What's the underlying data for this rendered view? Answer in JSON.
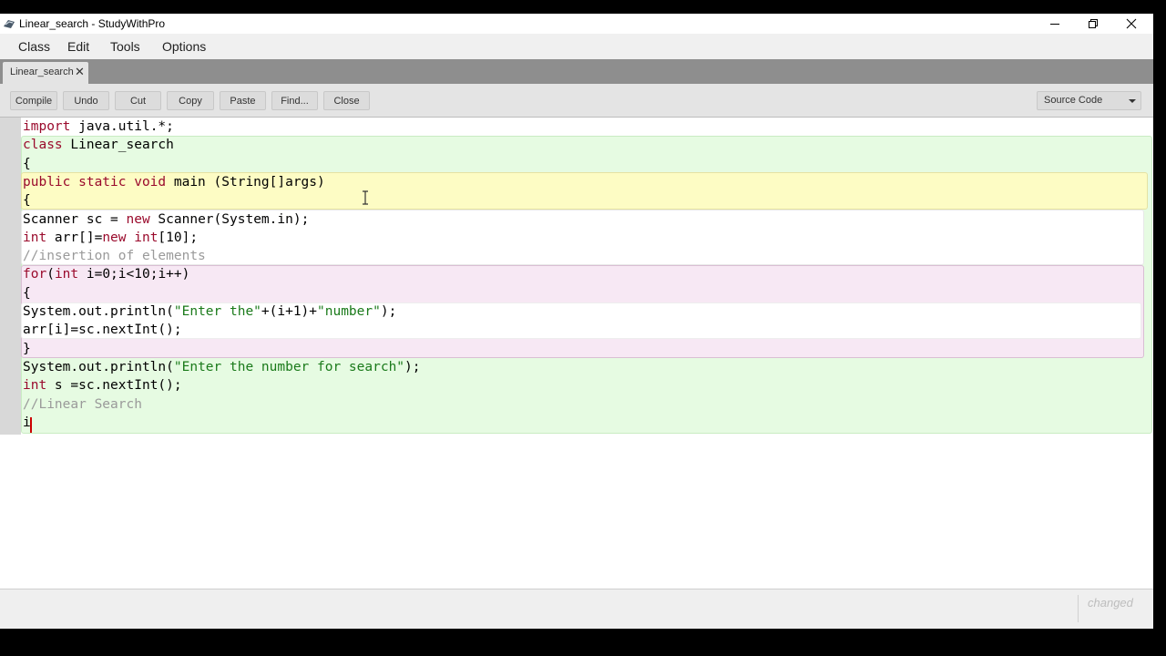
{
  "window": {
    "title": "Linear_search - StudyWithPro",
    "controls": {
      "minimize_icon": "minimize-icon",
      "restore_icon": "restore-icon",
      "close_icon": "close-icon"
    }
  },
  "menu": [
    "Class",
    "Edit",
    "Tools",
    "Options"
  ],
  "tab": {
    "label": "Linear_search",
    "close_glyph": "✕"
  },
  "toolbar": {
    "buttons": [
      "Compile",
      "Undo",
      "Cut",
      "Copy",
      "Paste",
      "Find...",
      "Close"
    ],
    "view_select": "Source Code"
  },
  "code": [
    [
      [
        "kw",
        "import"
      ],
      [
        "t",
        " java.util.*;"
      ]
    ],
    [
      [
        "kw",
        "class"
      ],
      [
        "t",
        " Linear_search"
      ]
    ],
    [
      [
        "t",
        "{"
      ]
    ],
    [
      [
        "kw",
        "public static void"
      ],
      [
        "t",
        " main (String[]args)"
      ]
    ],
    [
      [
        "t",
        "{"
      ]
    ],
    [
      [
        "t",
        "Scanner sc = "
      ],
      [
        "kw",
        "new"
      ],
      [
        "t",
        " Scanner(System.in);"
      ]
    ],
    [
      [
        "kw",
        "int"
      ],
      [
        "t",
        " arr[]="
      ],
      [
        "kw",
        "new int"
      ],
      [
        "t",
        "[10];"
      ]
    ],
    [
      [
        "cmt",
        "//insertion of elements"
      ]
    ],
    [
      [
        "kw",
        "for"
      ],
      [
        "t",
        "("
      ],
      [
        "kw",
        "int"
      ],
      [
        "t",
        " i=0;i<10;i++)"
      ]
    ],
    [
      [
        "t",
        "{"
      ]
    ],
    [
      [
        "t",
        "System.out.println("
      ],
      [
        "str",
        "\"Enter the\""
      ],
      [
        "t",
        "+(i+1)+"
      ],
      [
        "str",
        "\"number\""
      ],
      [
        "t",
        ");"
      ]
    ],
    [
      [
        "t",
        "arr[i]=sc.nextInt();"
      ]
    ],
    [
      [
        "t",
        "}"
      ]
    ],
    [
      [
        "t",
        "System.out.println("
      ],
      [
        "str",
        "\"Enter the number for search\""
      ],
      [
        "t",
        ");"
      ]
    ],
    [
      [
        "kw",
        "int"
      ],
      [
        "t",
        " s =sc.nextInt();"
      ]
    ],
    [
      [
        "cmt",
        "//Linear Search"
      ]
    ],
    [
      [
        "t",
        "i"
      ]
    ]
  ],
  "status": {
    "text": "changed"
  },
  "colors": {
    "class_scope": "#e6fbe2",
    "method_scope": "#fdfcc4",
    "loop_scope": "#f7e8f4",
    "keyword": "#9a0a2c",
    "string": "#1a7a1a",
    "comment": "#9a9a9a"
  }
}
